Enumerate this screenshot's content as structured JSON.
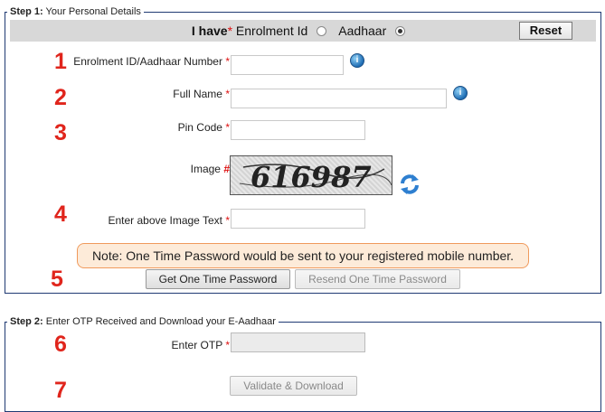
{
  "step1": {
    "legend_bold": "Step 1:",
    "legend_text": "Your Personal Details",
    "header": {
      "i_have": "I have",
      "required_mark": "*",
      "option_enrolment": "Enrolment Id",
      "option_aadhaar": "Aadhaar",
      "selected": "Aadhaar",
      "reset_label": "Reset"
    },
    "fields": {
      "enrolment_label": "Enrolment ID/Aadhaar Number",
      "full_name_label": "Full Name",
      "pin_code_label": "Pin Code",
      "image_label": "Image",
      "image_mark": "#",
      "captcha_text": "616987",
      "image_text_label": "Enter above Image Text",
      "required_mark": "*"
    },
    "note": "Note: One Time Password would be sent to your registered mobile number.",
    "get_otp_label": "Get One Time Password",
    "resend_otp_label": "Resend One Time Password"
  },
  "step2": {
    "legend_bold": "Step 2:",
    "legend_text": "Enter OTP Received and Download your E-Aadhaar",
    "otp_label": "Enter OTP",
    "required_mark": "*",
    "validate_label": "Validate & Download"
  },
  "step_numbers": [
    "1",
    "2",
    "3",
    "4",
    "5",
    "6",
    "7"
  ],
  "colors": {
    "panel_border": "#1f3a73",
    "step_number": "#e0251c",
    "required": "#dd1111",
    "note_bg": "#fdebd9",
    "note_border": "#f09a5c",
    "header_bg": "#d8d8d8"
  },
  "icons": [
    "info-icon",
    "refresh-icon"
  ]
}
